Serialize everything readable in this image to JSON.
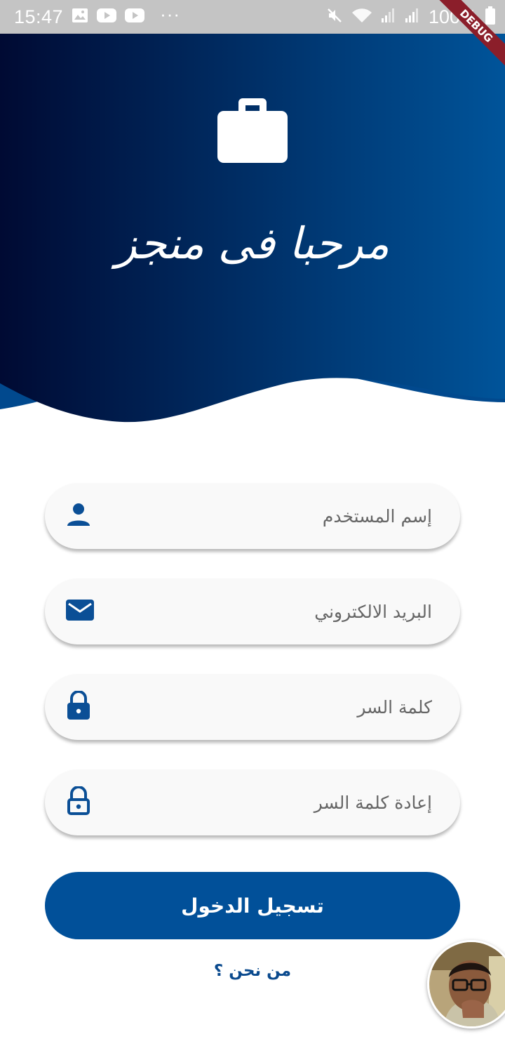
{
  "status_bar": {
    "time": "15:47",
    "battery": "100%",
    "left_icons": [
      "image-icon",
      "youtube-icon",
      "youtube-icon",
      "more-dots-icon"
    ],
    "right_icons": [
      "mute-icon",
      "wifi-icon",
      "signal-icon",
      "signal-icon",
      "battery-icon"
    ]
  },
  "debug_banner": "DEBUG",
  "header": {
    "icon": "briefcase-icon",
    "welcome_text": "مرحبا فى منجز",
    "gradient_colors": [
      "#000a33",
      "#00549a"
    ]
  },
  "form": {
    "fields": [
      {
        "icon": "person-icon",
        "placeholder": "إسم المستخدم"
      },
      {
        "icon": "mail-icon",
        "placeholder": "البريد الالكتروني"
      },
      {
        "icon": "lock-icon",
        "placeholder": "كلمة السر"
      },
      {
        "icon": "lock-outline-icon",
        "placeholder": "إعادة كلمة السر"
      }
    ],
    "submit_label": "تسجيل الدخول",
    "about_link": "من نحن ؟"
  },
  "colors": {
    "accent": "#015099",
    "link": "#0a4a8e",
    "field_bg": "#f9f9f9"
  }
}
